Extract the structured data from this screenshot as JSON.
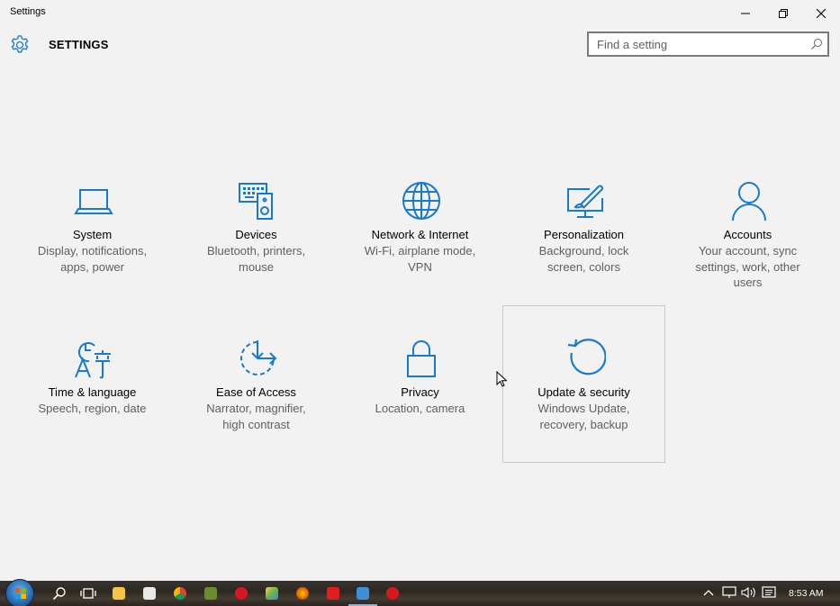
{
  "window": {
    "title": "Settings",
    "minimize_icon": "minimize-icon",
    "restore_icon": "restore-icon",
    "close_icon": "close-icon"
  },
  "header": {
    "title": "SETTINGS",
    "icon": "gear-icon",
    "search": {
      "placeholder": "Find a setting",
      "value": "",
      "icon": "search-icon"
    }
  },
  "accent_color": "#1979ca",
  "tiles": [
    {
      "label": "System",
      "desc1": "Display, notifications,",
      "desc2": "apps, power",
      "desc3": "",
      "icon": "laptop-icon"
    },
    {
      "label": "Devices",
      "desc1": "Bluetooth, printers,",
      "desc2": "mouse",
      "desc3": "",
      "icon": "keyboard-speaker-icon"
    },
    {
      "label": "Network & Internet",
      "desc1": "Wi-Fi, airplane mode,",
      "desc2": "VPN",
      "desc3": "",
      "icon": "globe-icon"
    },
    {
      "label": "Personalization",
      "desc1": "Background, lock",
      "desc2": "screen, colors",
      "desc3": "",
      "icon": "paint-monitor-icon"
    },
    {
      "label": "Accounts",
      "desc1": "Your account, sync",
      "desc2": "settings, work, other",
      "desc3": "users",
      "icon": "person-icon"
    },
    {
      "label": "Time & language",
      "desc1": "Speech, region, date",
      "desc2": "",
      "desc3": "",
      "icon": "clock-language-icon"
    },
    {
      "label": "Ease of Access",
      "desc1": "Narrator, magnifier,",
      "desc2": "high contrast",
      "desc3": "",
      "icon": "ease-of-access-icon"
    },
    {
      "label": "Privacy",
      "desc1": "Location, camera",
      "desc2": "",
      "desc3": "",
      "icon": "lock-icon"
    },
    {
      "label": "Update & security",
      "desc1": "Windows Update,",
      "desc2": "recovery, backup",
      "desc3": "",
      "icon": "refresh-icon"
    }
  ],
  "taskbar": {
    "clock": "8:53 AM",
    "pinned": [
      "search-icon",
      "task-view-icon",
      "file-explorer-icon",
      "store-icon",
      "chrome-icon",
      "app-icon",
      "opera-icon",
      "photos-icon",
      "firefox-icon",
      "app-icon",
      "settings-icon",
      "app-icon"
    ]
  }
}
